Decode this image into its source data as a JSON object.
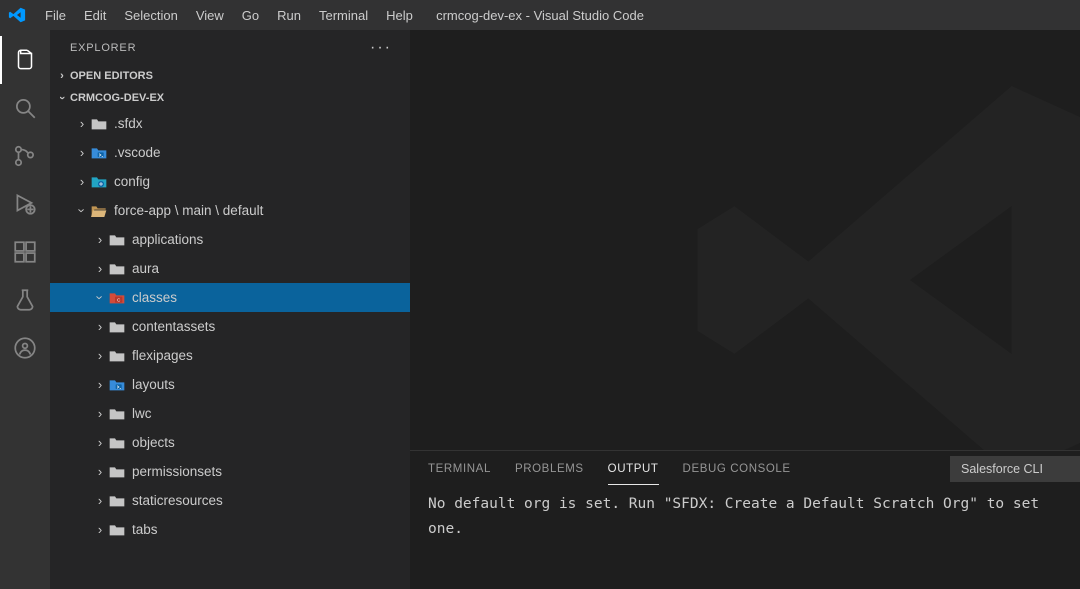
{
  "window_title": "crmcog-dev-ex - Visual Studio Code",
  "menu": [
    "File",
    "Edit",
    "Selection",
    "View",
    "Go",
    "Run",
    "Terminal",
    "Help"
  ],
  "sidebar": {
    "title": "EXPLORER",
    "sections": {
      "open_editors": "OPEN EDITORS",
      "project": "CRMCOG-DEV-EX"
    },
    "tree": [
      {
        "label": ".sfdx",
        "depth": 1,
        "expanded": false,
        "iconColor": "gray"
      },
      {
        "label": ".vscode",
        "depth": 1,
        "expanded": false,
        "iconColor": "blue"
      },
      {
        "label": "config",
        "depth": 1,
        "expanded": false,
        "iconColor": "cyan"
      },
      {
        "label": "force-app \\ main \\ default",
        "depth": 1,
        "expanded": true,
        "iconColor": "open"
      },
      {
        "label": "applications",
        "depth": 2,
        "expanded": false,
        "iconColor": "gray"
      },
      {
        "label": "aura",
        "depth": 2,
        "expanded": false,
        "iconColor": "gray"
      },
      {
        "label": "classes",
        "depth": 2,
        "expanded": true,
        "iconColor": "red",
        "selected": true
      },
      {
        "label": "contentassets",
        "depth": 2,
        "expanded": false,
        "iconColor": "gray"
      },
      {
        "label": "flexipages",
        "depth": 2,
        "expanded": false,
        "iconColor": "gray"
      },
      {
        "label": "layouts",
        "depth": 2,
        "expanded": false,
        "iconColor": "blue"
      },
      {
        "label": "lwc",
        "depth": 2,
        "expanded": false,
        "iconColor": "gray"
      },
      {
        "label": "objects",
        "depth": 2,
        "expanded": false,
        "iconColor": "gray"
      },
      {
        "label": "permissionsets",
        "depth": 2,
        "expanded": false,
        "iconColor": "gray"
      },
      {
        "label": "staticresources",
        "depth": 2,
        "expanded": false,
        "iconColor": "gray"
      },
      {
        "label": "tabs",
        "depth": 2,
        "expanded": false,
        "iconColor": "gray"
      }
    ]
  },
  "panel": {
    "tabs": [
      "TERMINAL",
      "PROBLEMS",
      "OUTPUT",
      "DEBUG CONSOLE"
    ],
    "active_tab": "OUTPUT",
    "channel": "Salesforce CLI",
    "output_text": "No default org is set. Run \"SFDX: Create a Default Scratch Org\" to set one."
  }
}
